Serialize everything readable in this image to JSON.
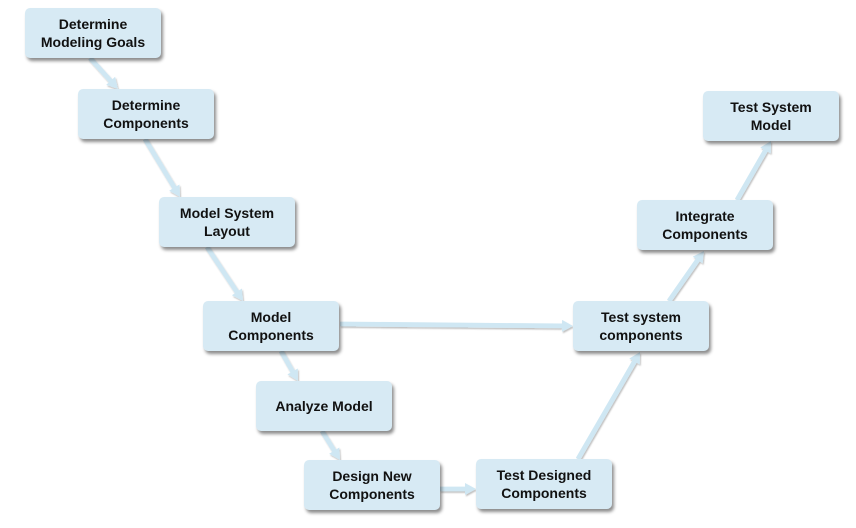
{
  "colors": {
    "node_fill": "#d7eaf4",
    "arrow": "#cfe7f3",
    "text": "#111111"
  },
  "nodes": [
    {
      "id": "determine-modeling-goals",
      "label": "Determine Modeling Goals"
    },
    {
      "id": "determine-components",
      "label": "Determine Components"
    },
    {
      "id": "model-system-layout",
      "label": "Model System Layout"
    },
    {
      "id": "model-components",
      "label": "Model Components"
    },
    {
      "id": "analyze-model",
      "label": "Analyze Model"
    },
    {
      "id": "design-new-components",
      "label": "Design New Components"
    },
    {
      "id": "test-designed-components",
      "label": "Test Designed Components"
    },
    {
      "id": "test-system-components",
      "label": "Test system components"
    },
    {
      "id": "integrate-components",
      "label": "Integrate Components"
    },
    {
      "id": "test-system-model",
      "label": "Test System Model"
    }
  ],
  "edges": [
    {
      "from": "determine-modeling-goals",
      "to": "determine-components"
    },
    {
      "from": "determine-components",
      "to": "model-system-layout"
    },
    {
      "from": "model-system-layout",
      "to": "model-components"
    },
    {
      "from": "model-components",
      "to": "analyze-model"
    },
    {
      "from": "analyze-model",
      "to": "design-new-components"
    },
    {
      "from": "design-new-components",
      "to": "test-designed-components"
    },
    {
      "from": "test-designed-components",
      "to": "test-system-components"
    },
    {
      "from": "model-components",
      "to": "test-system-components"
    },
    {
      "from": "test-system-components",
      "to": "integrate-components"
    },
    {
      "from": "integrate-components",
      "to": "test-system-model"
    }
  ]
}
